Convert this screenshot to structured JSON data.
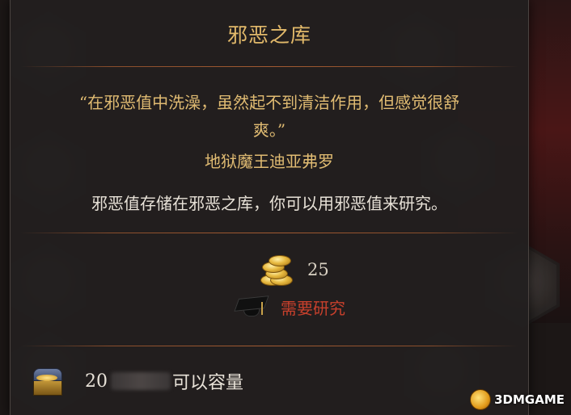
{
  "tooltip": {
    "title": "邪恶之库",
    "quote_line1": "“在邪恶值中洗澡，虽然起不到清洁作用，但感觉很舒",
    "quote_line2": "爽。”",
    "author": "地狱魔王迪亚弗罗",
    "description": "邪恶值存储在邪恶之库，你可以用邪恶值来研究。",
    "cost": {
      "icon": "gold-coins-icon",
      "value": "25"
    },
    "requirement": {
      "icon": "graduation-cap-icon",
      "label": "需要研究",
      "color": "#c8402c"
    },
    "capacity": {
      "icon": "treasure-chest-icon",
      "value_visible": "20",
      "label_visible": "可以容量"
    }
  },
  "colors": {
    "title": "#e2b96a",
    "quote": "#e0bb72",
    "body_text": "#e8e2d8",
    "divider": "#a35b32"
  },
  "watermark": {
    "text": "3DMGAME"
  }
}
